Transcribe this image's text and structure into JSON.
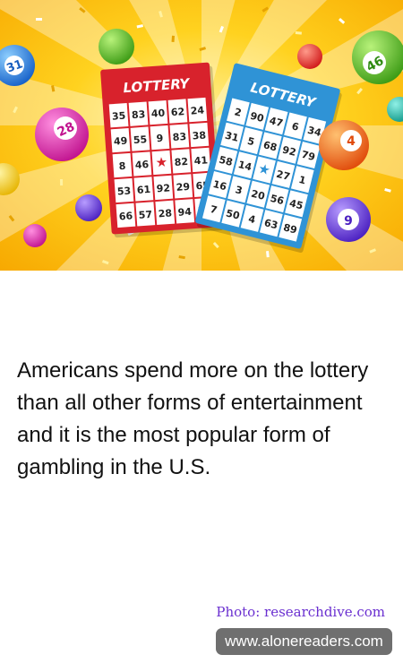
{
  "hero": {
    "ticket_left": {
      "title": "LOTTERY",
      "rows": [
        [
          "35",
          "83",
          "40",
          "62",
          "24"
        ],
        [
          "49",
          "55",
          "9",
          "83",
          "38"
        ],
        [
          "8",
          "46",
          "★",
          "82",
          "41"
        ],
        [
          "53",
          "61",
          "92",
          "29",
          "65"
        ],
        [
          "66",
          "57",
          "28",
          "94",
          "10"
        ]
      ]
    },
    "ticket_right": {
      "title": "LOTTERY",
      "rows": [
        [
          "2",
          "90",
          "47",
          "6",
          "34"
        ],
        [
          "31",
          "5",
          "68",
          "92",
          "79"
        ],
        [
          "58",
          "14",
          "★",
          "27",
          "1"
        ],
        [
          "16",
          "3",
          "20",
          "56",
          "45"
        ],
        [
          "7",
          "50",
          "4",
          "63",
          "89"
        ]
      ]
    },
    "balls": [
      "31",
      "28",
      "46",
      "4",
      "9"
    ]
  },
  "fact_text": "Americans spend more on the lottery than all other forms of entertainment and it is the most popular form of gambling in the U.S.",
  "credit": "Photo: researchdive.com",
  "website": "www.alonereaders.com",
  "colors": {
    "background": "#ffffff",
    "text": "#111111",
    "credit": "#6a2fd0",
    "badge": "#6f6f6f",
    "ticket_red": "#d8222c",
    "ticket_blue": "#2f93d6",
    "hero_yellow": "#ffd21f"
  }
}
